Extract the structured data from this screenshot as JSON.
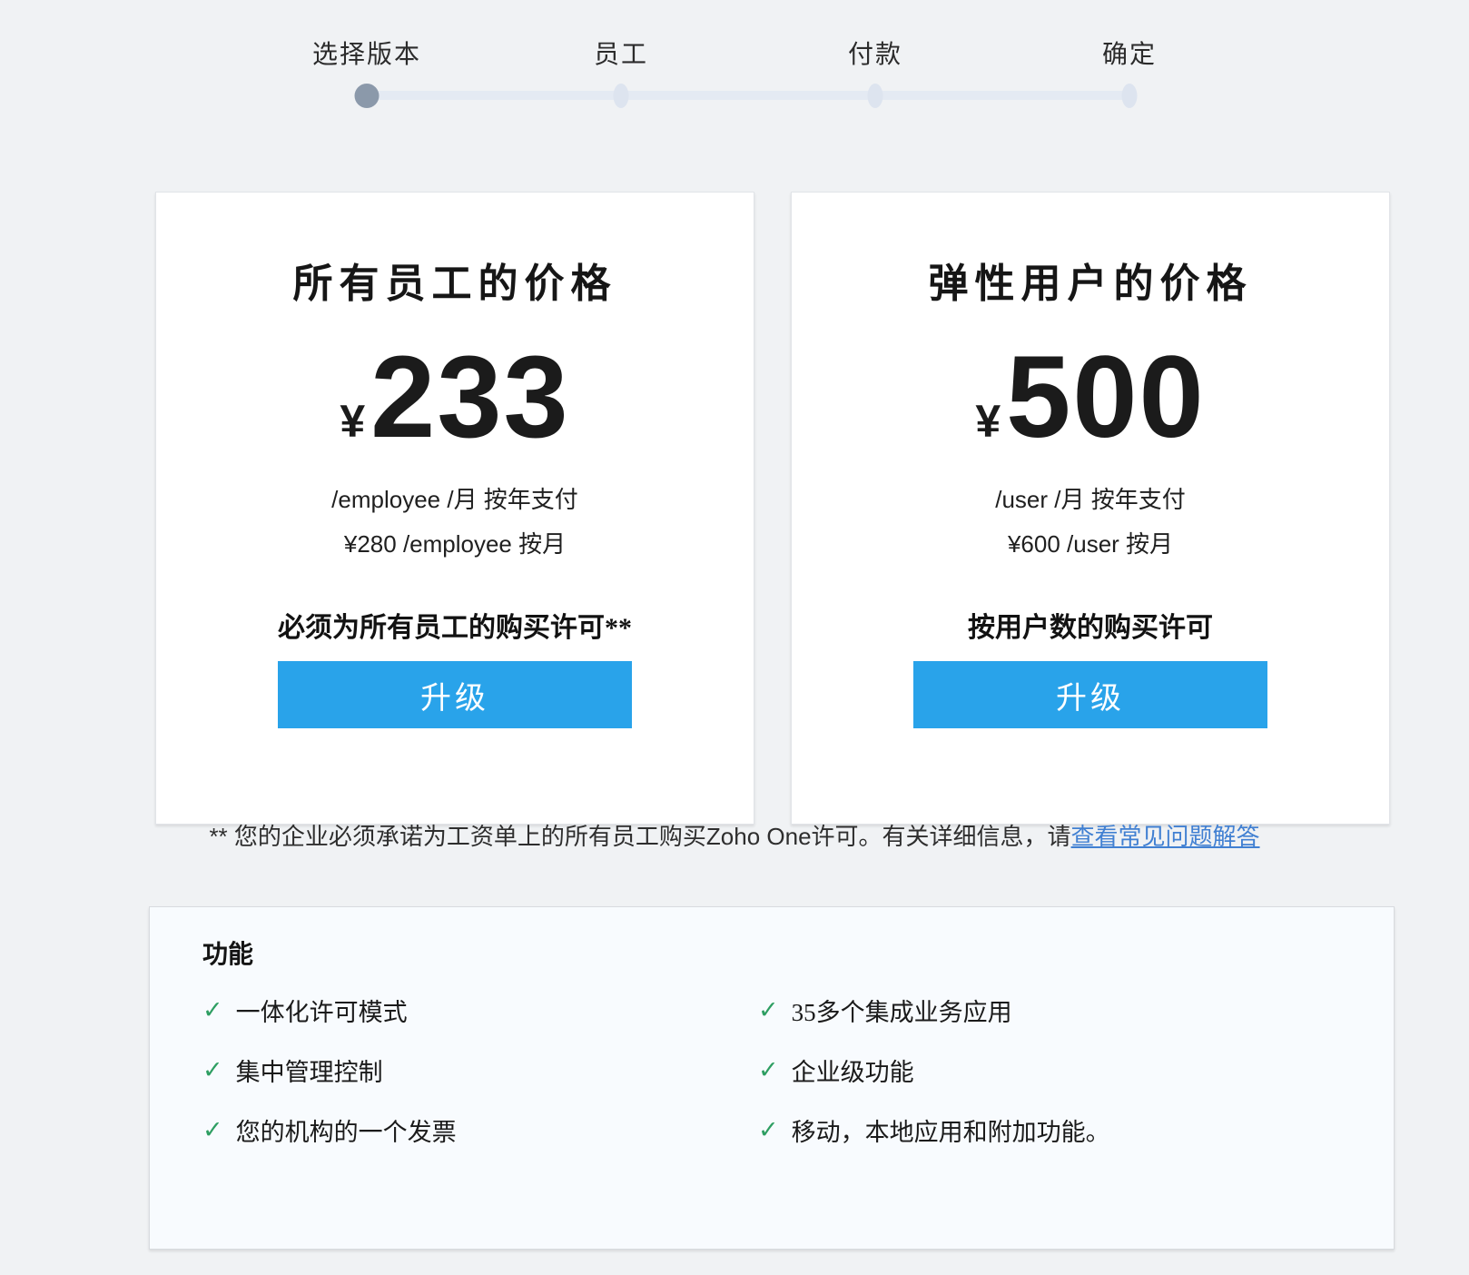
{
  "stepper": {
    "steps": [
      {
        "label": "选择版本",
        "active": true
      },
      {
        "label": "员工",
        "active": false
      },
      {
        "label": "付款",
        "active": false
      },
      {
        "label": "确定",
        "active": false
      }
    ]
  },
  "plans": [
    {
      "title": "所有员工的价格",
      "currency": "¥",
      "price": "233",
      "billing_line1": "/employee /月 按年支付",
      "billing_line2": "¥280 /employee 按月",
      "license_note": "必须为所有员工的购买许可**",
      "cta_label": "升级"
    },
    {
      "title": "弹性用户的价格",
      "currency": "¥",
      "price": "500",
      "billing_line1": "/user /月 按年支付",
      "billing_line2": "¥600 /user 按月",
      "license_note": "按用户数的购买许可",
      "cta_label": "升级"
    }
  ],
  "footnote": {
    "text": "** 您的企业必须承诺为工资单上的所有员工购买Zoho One许可。有关详细信息，请",
    "link_label": "查看常见问题解答"
  },
  "features": {
    "heading": "功能",
    "check_icon": "✓",
    "columns": [
      [
        "一体化许可模式",
        "集中管理控制",
        "您的机构的一个发票"
      ],
      [
        "35多个集成业务应用",
        "企业级功能",
        "移动，本地应用和附加功能。"
      ]
    ]
  },
  "colors": {
    "accent_blue": "#29a3ea",
    "link_blue": "#4180d2",
    "check_green": "#2e9e62",
    "active_step_gray": "#8b99aa",
    "track_gray_blue": "#e4eaf3",
    "page_background": "#f0f2f4"
  }
}
